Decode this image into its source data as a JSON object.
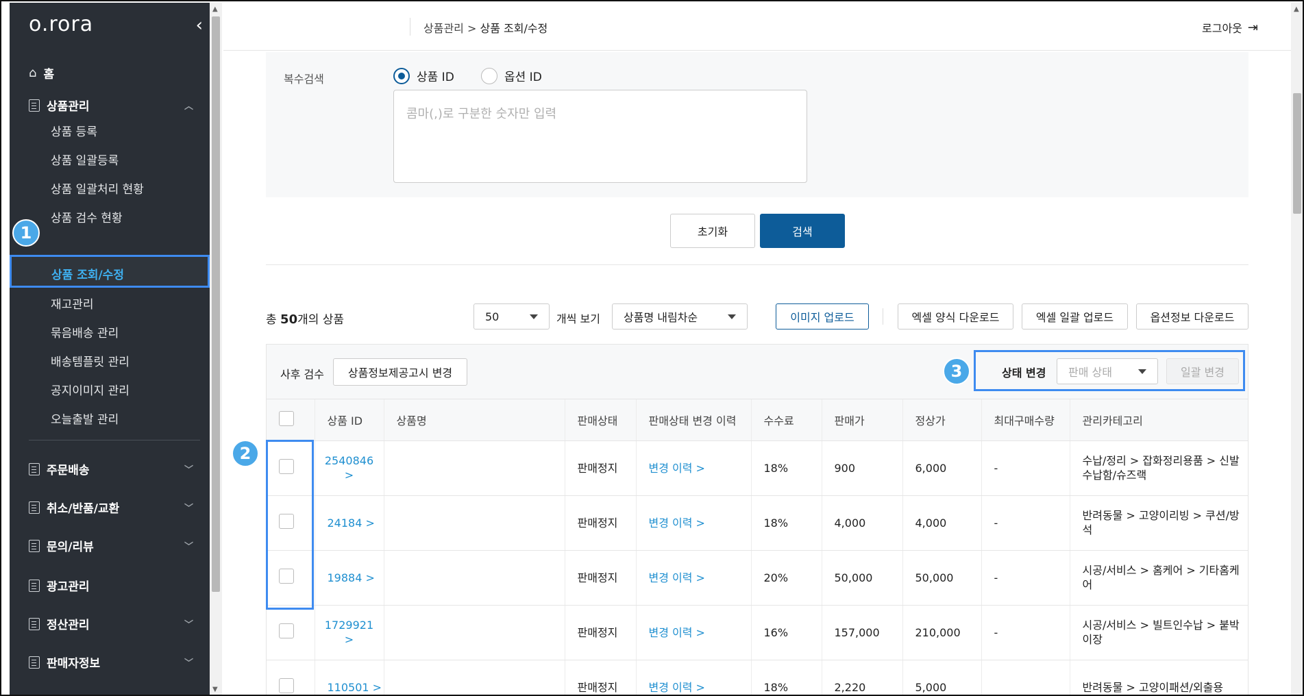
{
  "sidebar": {
    "logo": "o.rora",
    "collapse_icon": "‹",
    "home": "홈",
    "product_mgmt": "상품관리",
    "sub_items": [
      "상품 등록",
      "상품 일괄등록",
      "상품 일괄처리 현황",
      "상품 검수 현황",
      "상품 조회/수정",
      "재고관리",
      "묶음배송 관리",
      "배송템플릿 관리",
      "공지이미지 관리",
      "오늘출발 관리"
    ],
    "sections": [
      "주문배송",
      "취소/반품/교환",
      "문의/리뷰",
      "광고관리",
      "정산관리",
      "판매자정보"
    ]
  },
  "badges": [
    "1",
    "2",
    "3"
  ],
  "header": {
    "breadcrumb_parent": "상품관리",
    "breadcrumb_sep": ">",
    "breadcrumb_current": "상품 조회/수정",
    "logout": "로그아웃"
  },
  "search": {
    "multi_label": "복수검색",
    "radio_product": "상품 ID",
    "radio_option": "옵션 ID",
    "placeholder": "콤마(,)로 구분한 숫자만 입력",
    "reset": "초기화",
    "search": "검색"
  },
  "toolbar": {
    "total_prefix": "총 ",
    "total_count": "50",
    "total_suffix": "개의 상품",
    "per_page": "50",
    "view_label": "개씩 보기",
    "sort": "상품명 내림차순",
    "image_upload": "이미지 업로드",
    "excel_form": "엑셀 양식 다운로드",
    "excel_upload": "엑셀 일괄 업로드",
    "option_download": "옵션정보 다운로드"
  },
  "filter": {
    "post_review": "사후 검수",
    "notice_change": "상품정보제공고시 변경",
    "status_change": "상태 변경",
    "sale_status": "판매 상태",
    "bulk_change": "일괄 변경"
  },
  "table": {
    "headers": [
      "상품 ID",
      "상품명",
      "판매상태",
      "판매상태 변경 이력",
      "수수료",
      "판매가",
      "정상가",
      "최대구매수량",
      "관리카테고리"
    ],
    "rows": [
      {
        "id": "2540846",
        "id2": ">",
        "status": "판매정지",
        "history": "변경 이력 >",
        "fee": "18%",
        "price": "900",
        "list_price": "6,000",
        "max_qty": "-",
        "category": "수납/정리 > 잡화정리용품 > 신발수납함/슈즈랙"
      },
      {
        "id": "24184 >",
        "id2": "",
        "status": "판매정지",
        "history": "변경 이력 >",
        "fee": "18%",
        "price": "4,000",
        "list_price": "4,000",
        "max_qty": "-",
        "category": "반려동물 > 고양이리빙 > 쿠션/방석"
      },
      {
        "id": "19884 >",
        "id2": "",
        "status": "판매정지",
        "history": "변경 이력 >",
        "fee": "20%",
        "price": "50,000",
        "list_price": "50,000",
        "max_qty": "-",
        "category": "시공/서비스 > 홈케어 > 기타홈케어"
      },
      {
        "id": "1729921",
        "id2": ">",
        "status": "판매정지",
        "history": "변경 이력 >",
        "fee": "16%",
        "price": "157,000",
        "list_price": "210,000",
        "max_qty": "-",
        "category": "시공/서비스 > 빌트인수납 > 붙박이장"
      },
      {
        "id": "110501 >",
        "id2": "",
        "status": "판매정지",
        "history": "변경 이력 >",
        "fee": "18%",
        "price": "2,220",
        "list_price": "5,000",
        "max_qty": "",
        "category": "반려동물 > 고양이패션/외출용"
      }
    ]
  }
}
